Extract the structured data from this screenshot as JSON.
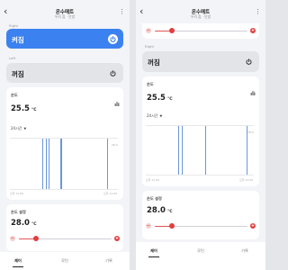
{
  "colors": {
    "accent": "#3b82f0",
    "tile_off": "#e2e4e8",
    "slider_red": "#e03f3f",
    "chart_bar": "#6b97d8",
    "background": "#f3f4f7"
  },
  "header": {
    "title": "온수매트",
    "subtitle": "우리 집 · 안방",
    "back_icon": "chevron-left-icon",
    "menu_icon": "more-vertical-icon"
  },
  "left_screen": {
    "right_control": {
      "section_label": "Right",
      "state": "켜짐",
      "power_on": true
    },
    "left_control": {
      "section_label": "Left",
      "state": "꺼짐",
      "power_on": false
    },
    "temperature": {
      "title": "온도",
      "value": "25.5",
      "unit": "°C",
      "range": "24시간",
      "y_max_label": "28.0",
      "x_start": "오후 11:00",
      "x_end": "오후 11:00"
    },
    "setpoint": {
      "title": "온도 설정",
      "value": "28.0",
      "unit": "°C",
      "level": 0.18
    }
  },
  "right_screen": {
    "top_slider_level": 0.18,
    "right_control": {
      "section_label": "Right",
      "state": "꺼짐",
      "power_on": false
    },
    "temperature": {
      "title": "온도",
      "value": "25.5",
      "unit": "°C",
      "range": "24시간",
      "y_max_label": "28.0",
      "x_start": "오후 11:00",
      "x_end": "오후 11:00"
    },
    "setpoint": {
      "title": "온도 설정",
      "value": "28.0",
      "unit": "°C",
      "level": 0.18
    }
  },
  "bottom_nav": {
    "items": [
      {
        "label": "제어",
        "active": true
      },
      {
        "label": "루틴",
        "active": false
      },
      {
        "label": "기록",
        "active": false
      }
    ]
  },
  "chart_data": [
    {
      "type": "bar",
      "title": "온도",
      "x_labels": [
        "오후 11:00",
        "오후 11:00"
      ],
      "y_max": 28.0,
      "series": [
        {
          "values": [
            1,
            1,
            1,
            1,
            1
          ]
        }
      ],
      "positions": [
        0.3,
        0.33,
        0.36,
        0.47,
        0.9
      ]
    },
    {
      "type": "bar",
      "title": "온도",
      "x_labels": [
        "오후 11:00",
        "오후 11:00"
      ],
      "y_max": 28.0,
      "series": [
        {
          "values": [
            1,
            1,
            1,
            1
          ]
        }
      ],
      "positions": [
        0.3,
        0.33,
        0.55,
        0.93
      ]
    }
  ]
}
